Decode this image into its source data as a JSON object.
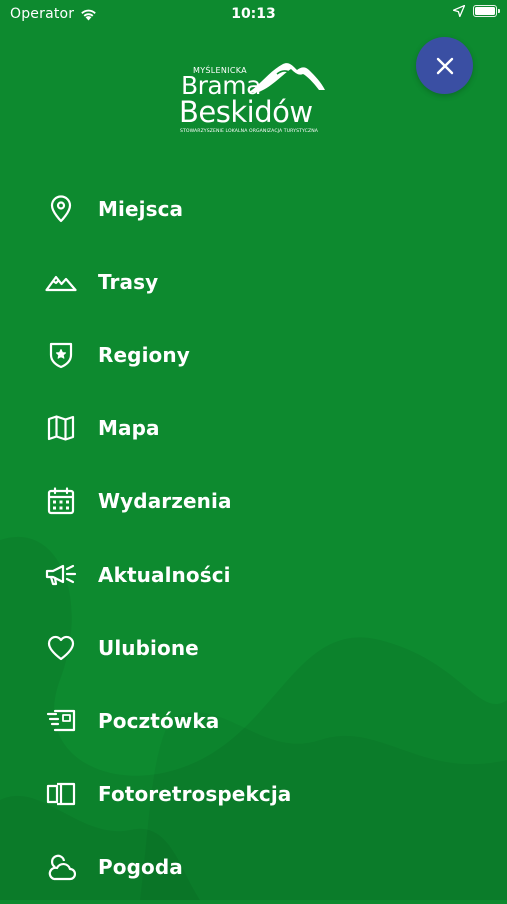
{
  "colors": {
    "background": "#0d8a2f",
    "close_button": "#3a4fa3",
    "text": "#ffffff"
  },
  "status_bar": {
    "carrier": "Operator",
    "time": "10:13",
    "battery_level": 1.0
  },
  "logo": {
    "line_top": "MYŚLENICKA",
    "line1": "Brama",
    "line2": "Beskidów",
    "subtitle": "STOWARZYSZENIE LOKALNA ORGANIZACJA TURYSTYCZNA"
  },
  "close_button": {
    "icon": "close-icon"
  },
  "menu": {
    "items": [
      {
        "label": "Miejsca",
        "icon": "map-pin-icon"
      },
      {
        "label": "Trasy",
        "icon": "mountain-icon"
      },
      {
        "label": "Regiony",
        "icon": "shield-star-icon"
      },
      {
        "label": "Mapa",
        "icon": "map-icon"
      },
      {
        "label": "Wydarzenia",
        "icon": "calendar-icon"
      },
      {
        "label": "Aktualności",
        "icon": "megaphone-icon"
      },
      {
        "label": "Ulubione",
        "icon": "heart-icon"
      },
      {
        "label": "Pocztówka",
        "icon": "postcard-icon"
      },
      {
        "label": "Fotoretrospekcja",
        "icon": "photo-compare-icon"
      },
      {
        "label": "Pogoda",
        "icon": "weather-cloud-icon"
      }
    ]
  }
}
